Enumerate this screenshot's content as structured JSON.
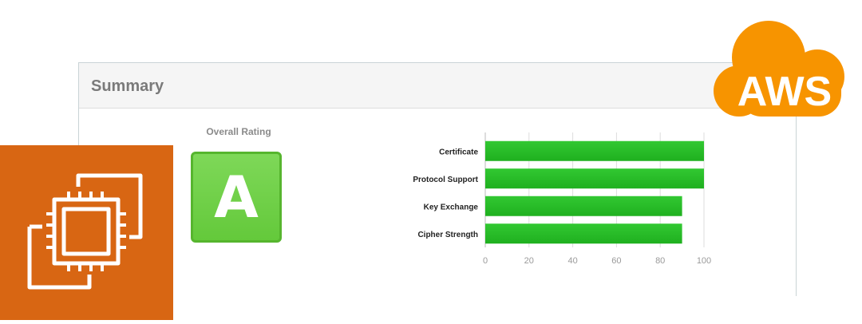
{
  "summary": {
    "title": "Summary",
    "overall_rating_label": "Overall Rating",
    "grade": "A"
  },
  "chart_data": {
    "type": "bar",
    "orientation": "horizontal",
    "categories": [
      "Certificate",
      "Protocol Support",
      "Key Exchange",
      "Cipher Strength"
    ],
    "values": [
      100,
      100,
      90,
      90
    ],
    "xlim": [
      0,
      100
    ],
    "xticks": [
      "0",
      "20",
      "40",
      "60",
      "80",
      "100"
    ],
    "grid": true,
    "bar_color": "#1fb01f"
  },
  "aws_logo": {
    "text": "AWS",
    "color": "#f79400"
  },
  "ec2_icon": {
    "background": "#d86613"
  }
}
